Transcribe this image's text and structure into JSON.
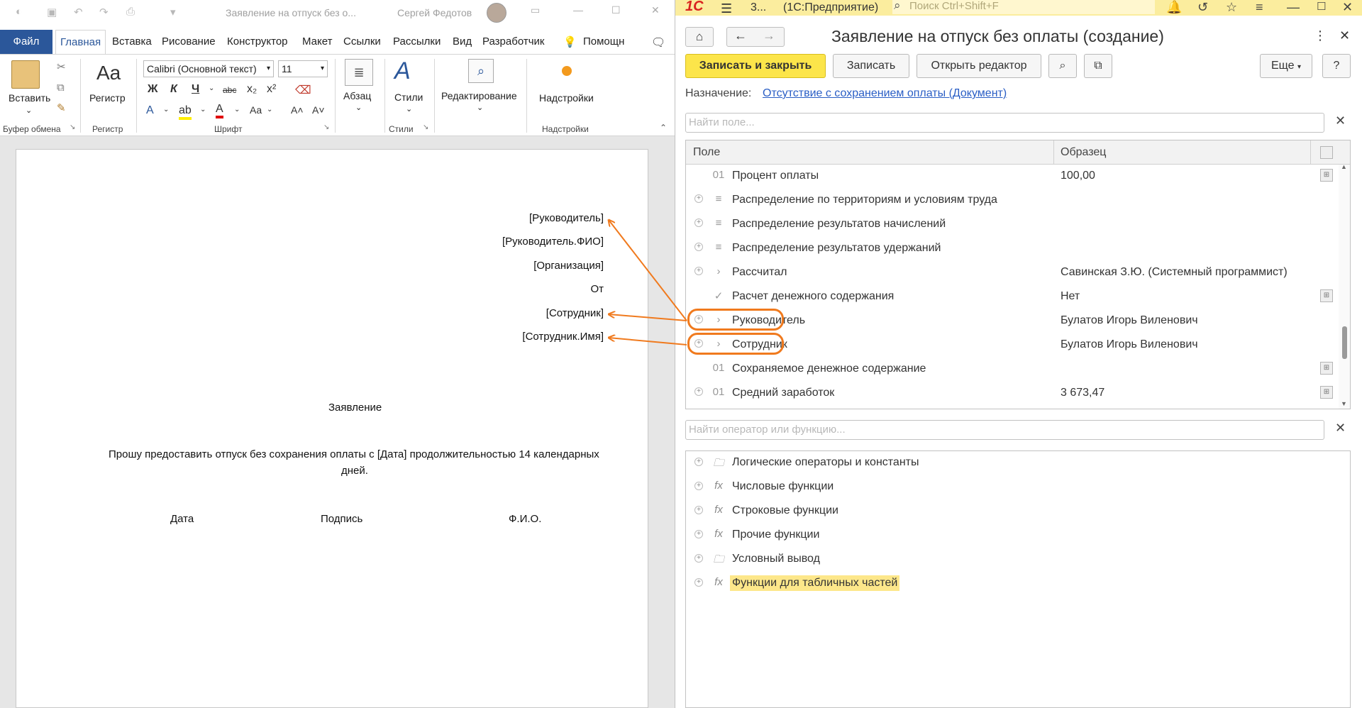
{
  "word": {
    "title": "Заявление на отпуск без о...",
    "user": "Сергей Федотов",
    "tabs": [
      "Файл",
      "Главная",
      "Вставка",
      "Рисование",
      "Конструктор",
      "Макет",
      "Ссылки",
      "Рассылки",
      "Вид",
      "Разработчик",
      "Помощн"
    ],
    "ribbon": {
      "paste": "Вставить",
      "clipboard_group": "Буфер обмена",
      "register_button": "Регистр",
      "register_icon_text": "Aa",
      "register_group": "Регистр",
      "font_name": "Calibri (Основной текст)",
      "font_size": "11",
      "font_group": "Шрифт",
      "bold": "Ж",
      "italic": "К",
      "underline": "Ч",
      "strike": "abc",
      "subscript": "x₂",
      "superscript": "x²",
      "case": "Aa",
      "grow": "A˄",
      "shrink": "A˅",
      "paragraph": "Абзац",
      "styles": "Стили",
      "styles_group": "Стили",
      "editing": "Редактирование",
      "addins": "Надстройки",
      "addins_group": "Надстройки"
    },
    "doc": {
      "line1": "[Руководитель]",
      "line2": "[Руководитель.ФИО]",
      "line3": "[Организация]",
      "line4": "От",
      "line5": "[Сотрудник]",
      "line6": "[Сотрудник.Имя]",
      "heading": "Заявление",
      "body_line1": "Прошу предоставить отпуск без сохранения оплаты с [Дата] продолжительностью 14 календарных",
      "body_line2": "дней.",
      "sig_date": "Дата",
      "sig_sign": "Подпись",
      "sig_fio": "Ф.И.О."
    }
  },
  "onec": {
    "topbar": {
      "logo": "1С",
      "tab_short": "3...",
      "app_name": "(1С:Предприятие)",
      "search_placeholder": "Поиск Ctrl+Shift+F"
    },
    "title": "Заявление на отпуск без оплаты (создание)",
    "buttons": {
      "save_close": "Записать и закрыть",
      "save": "Записать",
      "open_editor": "Открыть редактор",
      "more": "Еще",
      "help": "?"
    },
    "purpose_label": "Назначение:",
    "purpose_value": "Отсутствие с сохранением оплаты (Документ)",
    "field_search_placeholder": "Найти поле...",
    "columns": {
      "field": "Поле",
      "sample": "Образец"
    },
    "rows": [
      {
        "icon": "01",
        "name": "Процент оплаты",
        "value": "100,00",
        "expand": false
      },
      {
        "icon": "≡",
        "name": "Распределение по территориям и условиям труда",
        "value": "",
        "expand": true
      },
      {
        "icon": "≡",
        "name": "Распределение результатов начислений",
        "value": "",
        "expand": true
      },
      {
        "icon": "≡",
        "name": "Распределение результатов удержаний",
        "value": "",
        "expand": true
      },
      {
        "icon": "›",
        "name": "Рассчитал",
        "value": "Савинская З.Ю. (Системный программист)",
        "expand": true
      },
      {
        "icon": "✓",
        "name": "Расчет денежного содержания",
        "value": "Нет",
        "expand": false
      },
      {
        "icon": "›",
        "name": "Руководитель",
        "value": "Булатов Игорь Виленович",
        "expand": true
      },
      {
        "icon": "›",
        "name": "Сотрудник",
        "value": "Булатов Игорь Виленович",
        "expand": true
      },
      {
        "icon": "01",
        "name": "Сохраняемое денежное содержание",
        "value": "",
        "expand": false
      },
      {
        "icon": "01",
        "name": "Средний заработок",
        "value": "3 673,47",
        "expand": true
      }
    ],
    "func_search_placeholder": "Найти оператор или функцию...",
    "functions": [
      {
        "icon": "folder",
        "name": "Логические операторы и константы"
      },
      {
        "icon": "fx",
        "name": "Числовые функции"
      },
      {
        "icon": "fx",
        "name": "Строковые функции"
      },
      {
        "icon": "fx",
        "name": "Прочие функции"
      },
      {
        "icon": "folder",
        "name": "Условный вывод"
      },
      {
        "icon": "fx",
        "name": "Функции для табличных частей",
        "selected": true
      }
    ]
  },
  "colors": {
    "word_blue": "#2b579a",
    "onec_yellow": "#fbed9e",
    "button_yellow": "#fce54a",
    "highlight_orange": "#f07a1e",
    "link_blue": "#2a5ec5"
  }
}
